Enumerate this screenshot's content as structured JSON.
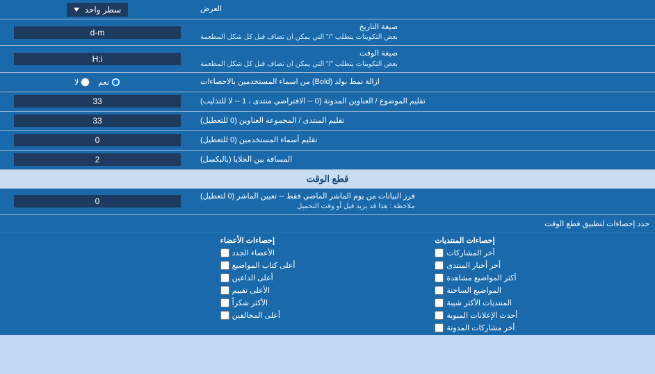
{
  "page": {
    "title": "العرض",
    "rows": [
      {
        "id": "display-mode",
        "label": "العرض",
        "input_type": "dropdown",
        "value": "سطر واحد"
      },
      {
        "id": "date-format",
        "label": "صيغة التاريخ",
        "sublabel": "بعض التكوينات يتطلب \"/\" التي يمكن ان تضاف قبل كل شكل المطعمة",
        "input_type": "text",
        "value": "d-m"
      },
      {
        "id": "time-format",
        "label": "صيغة الوقت",
        "sublabel": "بعض التكوينات يتطلب \"/\" التي يمكن ان تضاف قبل كل شكل المطعمة",
        "input_type": "text",
        "value": "H:i"
      },
      {
        "id": "bold-remove",
        "label": "ازالة نمط بولد (Bold) من اسماء المستخدمين بالاحصاءات",
        "input_type": "radio",
        "options": [
          "نعم",
          "لا"
        ],
        "selected": "نعم"
      },
      {
        "id": "subject-title",
        "label": "تقليم الموضوع / العناوين المدونة (0 -- الافتراضي منتدى ، 1 -- لا للتذليب)",
        "input_type": "text",
        "value": "33"
      },
      {
        "id": "forum-title",
        "label": "تقليم المنتدى / المجموعة العناوين (0 للتعطيل)",
        "input_type": "text",
        "value": "33"
      },
      {
        "id": "usernames",
        "label": "تقليم أسماء المستخدمين (0 للتعطيل)",
        "input_type": "text",
        "value": "0"
      },
      {
        "id": "cell-spacing",
        "label": "المسافة بين الخلايا (بالبكسل)",
        "input_type": "text",
        "value": "2"
      }
    ],
    "cutoff_section": {
      "title": "قطع الوقت",
      "rows": [
        {
          "id": "cutoff-days",
          "label": "فرز البيانات من يوم الماشر الماضي فقط -- تعيين الماشر (0 لتعطيل)",
          "sublabel": "ملاحظة : هذا قد يزيد قيل أو وقت التحميل",
          "input_type": "text",
          "value": "0"
        }
      ]
    },
    "checkboxes_section": {
      "limit_label": "حدد إحصاءات لتطبيق قطع الوقت",
      "col1_header": "إحصاءات المنتديات",
      "col2_header": "إحصاءات الأعضاء",
      "col3_header": "",
      "col1_items": [
        "أخر المشاركات",
        "أخر أخبار المنتدى",
        "أكثر المواضيع مشاهدة",
        "المواضيع الساخنة",
        "المنتديات الأكثر شيبة",
        "أحدث الإعلانات المبوبة",
        "أخر مشاركات المدونة"
      ],
      "col2_items": [
        "الأعضاء الجدد",
        "أعلى كتاب المواضيع",
        "أعلى الداعين",
        "الأعلى تقييم",
        "الأكثر شكراً",
        "أعلى المخالفين"
      ],
      "col3_items": []
    }
  }
}
